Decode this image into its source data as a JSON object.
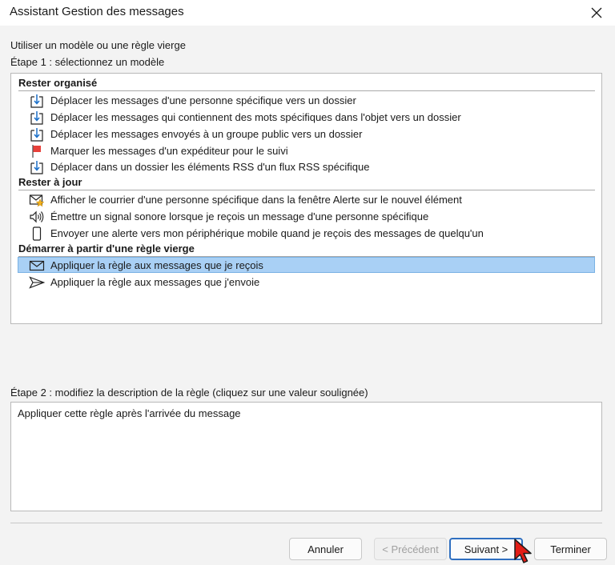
{
  "window": {
    "title": "Assistant Gestion des messages"
  },
  "labels": {
    "template_choice": "Utiliser un modèle ou une règle vierge",
    "step1": "Étape 1 : sélectionnez un modèle",
    "step2": "Étape 2 : modifiez la description de la règle (cliquez sur une valeur soulignée)"
  },
  "groups": [
    {
      "heading": "Rester organisé",
      "items": [
        {
          "label": "Déplacer les messages d'une personne spécifique vers un dossier",
          "icon": "move-to-folder-icon"
        },
        {
          "label": "Déplacer les messages qui contiennent des mots spécifiques dans l'objet vers un dossier",
          "icon": "move-to-folder-icon"
        },
        {
          "label": "Déplacer les messages envoyés à un groupe public vers un dossier",
          "icon": "move-to-folder-icon"
        },
        {
          "label": "Marquer les messages d'un expéditeur pour le suivi",
          "icon": "flag-icon"
        },
        {
          "label": "Déplacer dans un dossier les éléments RSS d'un flux RSS spécifique",
          "icon": "move-to-folder-icon"
        }
      ]
    },
    {
      "heading": "Rester à jour",
      "items": [
        {
          "label": "Afficher le courrier d'une personne spécifique dans la fenêtre Alerte sur le nouvel élément",
          "icon": "mail-alert-icon"
        },
        {
          "label": "Émettre un signal sonore lorsque je reçois un message d'une personne spécifique",
          "icon": "speaker-icon"
        },
        {
          "label": "Envoyer une alerte vers mon périphérique mobile quand je reçois des messages de quelqu'un",
          "icon": "mobile-device-icon"
        }
      ]
    },
    {
      "heading": "Démarrer à partir d'une règle vierge",
      "items": [
        {
          "label": "Appliquer la règle aux messages que je reçois",
          "icon": "envelope-icon",
          "selected": true
        },
        {
          "label": "Appliquer la règle aux messages que j'envoie",
          "icon": "send-icon"
        }
      ]
    }
  ],
  "description": {
    "text": "Appliquer cette règle après l'arrivée du message"
  },
  "buttons": {
    "cancel": "Annuler",
    "previous": "< Précédent",
    "next": "Suivant >",
    "finish": "Terminer"
  }
}
